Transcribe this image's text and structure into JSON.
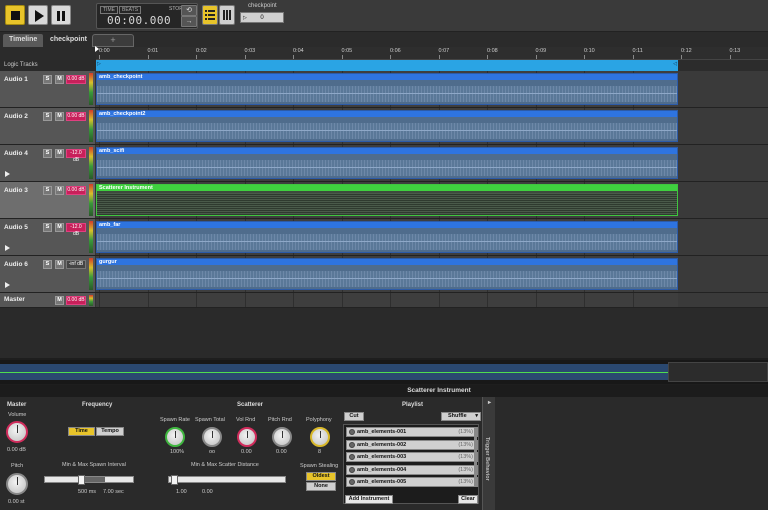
{
  "toolbar": {
    "time_tag": "TIME",
    "beats_tag": "BEATS",
    "status": "STOPPED",
    "time": "00:00.000",
    "checkpoint_label": "checkpoint",
    "checkpoint_value": "0"
  },
  "tabs": [
    {
      "label": "Timeline",
      "active": true
    },
    {
      "label": "checkpoint",
      "active": false
    }
  ],
  "add_tab": "+",
  "ruler": {
    "ticks": [
      "0:00",
      "0:01",
      "0:02",
      "0:03",
      "0:04",
      "0:05",
      "0:06",
      "0:07",
      "0:08",
      "0:09",
      "0:10",
      "0:11",
      "0:12",
      "0:13"
    ]
  },
  "logic_tracks_label": "Logic Tracks",
  "tracks": [
    {
      "name": "Audio 1",
      "vol": "0.00 dB",
      "clip": "amb_checkpoint",
      "color": "blue",
      "play": false
    },
    {
      "name": "Audio 2",
      "vol": "0.00 dB",
      "clip": "amb_checkpoint2",
      "color": "blue",
      "play": false
    },
    {
      "name": "Audio 4",
      "vol": "-12.0 dB",
      "clip": "amb_scifi",
      "color": "blue",
      "play": true
    },
    {
      "name": "Audio 3",
      "vol": "0.00 dB",
      "clip": "Scatterer Instrument",
      "color": "green",
      "play": false
    },
    {
      "name": "Audio 5",
      "vol": "-12.0 dB",
      "clip": "amb_far",
      "color": "blue",
      "play": true
    },
    {
      "name": "Audio 6",
      "vol": "-inf dB",
      "clip": "gurgur",
      "color": "blue",
      "play": true
    }
  ],
  "master_track": {
    "name": "Master",
    "vol": "0.00 dB"
  },
  "scatterer": {
    "title": "Scatterer Instrument",
    "master_section": "Master",
    "volume_label": "Volume",
    "volume_value": "0.00 dB",
    "pitch_label": "Pitch",
    "pitch_value": "0.00 st",
    "frequency_section": "Frequency",
    "time_btn": "Time",
    "tempo_btn": "Tempo",
    "spawn_interval_label": "Min & Max Spawn Interval",
    "spawn_interval_min": "500 ms",
    "spawn_interval_max": "7.00 sec",
    "scatterer_section": "Scatterer",
    "spawn_rate_label": "Spawn Rate",
    "spawn_rate_value": "100%",
    "spawn_total_label": "Spawn Total",
    "spawn_total_value": "oo",
    "vol_rnd_label": "Vol Rnd",
    "vol_rnd_value": "0.00",
    "pitch_rnd_label": "Pitch Rnd",
    "pitch_rnd_value": "0.00",
    "polyphony_label": "Polyphony",
    "polyphony_value": "8",
    "scatter_distance_label": "Min & Max Scatter Distance",
    "scatter_min": "1.00",
    "scatter_max": "0.00",
    "spawn_stealing_label": "Spawn Stealing",
    "oldest_btn": "Oldest",
    "none_btn": "None",
    "playlist_section": "Playlist",
    "cut_btn": "Cut",
    "shuffle_select": "Shuffle",
    "add_instrument_btn": "Add Instrument",
    "clear_btn": "Clear",
    "trigger_behavior": "Trigger Behavior",
    "playlist": [
      {
        "name": "amb_elements-001",
        "pct": "(13%)"
      },
      {
        "name": "amb_elements-002",
        "pct": "(13%)"
      },
      {
        "name": "amb_elements-003",
        "pct": "(13%)"
      },
      {
        "name": "amb_elements-004",
        "pct": "(13%)"
      },
      {
        "name": "amb_elements-005",
        "pct": "(13%)"
      }
    ]
  }
}
